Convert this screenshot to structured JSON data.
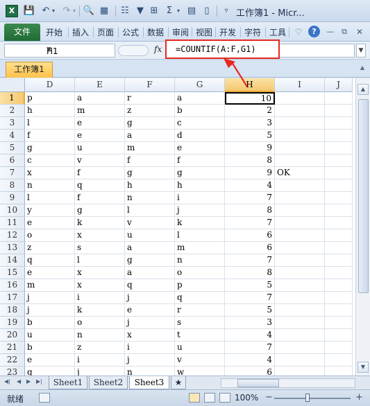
{
  "titlebar": {
    "app_icon": "X",
    "title": "工作簿1 - Micr...",
    "icons": [
      "excel-icon",
      "save-icon",
      "undo-icon",
      "redo-icon",
      "print-preview-icon",
      "format-icon",
      "filter-icon",
      "borders-icon",
      "sum-icon",
      "align-icon",
      "customize-icon"
    ]
  },
  "ribbon": {
    "file_tab": "文件",
    "tabs": [
      "开始",
      "插入",
      "页面",
      "公式",
      "数据",
      "审阅",
      "视图",
      "开发",
      "字符",
      "工具"
    ]
  },
  "formula_bar": {
    "name_box": "H1",
    "fx_label": "fx",
    "formula": "=COUNTIF(A:F,G1)"
  },
  "workbook_tab": "工作簿1",
  "grid": {
    "columns": [
      "D",
      "E",
      "F",
      "G",
      "H",
      "I",
      "J"
    ],
    "selected_column": "H",
    "selected_row": 1,
    "rows": [
      {
        "n": "1",
        "D": "p",
        "E": "a",
        "F": "r",
        "G": "a",
        "H": "10",
        "I": ""
      },
      {
        "n": "2",
        "D": "h",
        "E": "m",
        "F": "z",
        "G": "b",
        "H": "2",
        "I": ""
      },
      {
        "n": "3",
        "D": "l",
        "E": "e",
        "F": "g",
        "G": "c",
        "H": "3",
        "I": ""
      },
      {
        "n": "4",
        "D": "f",
        "E": "e",
        "F": "a",
        "G": "d",
        "H": "5",
        "I": ""
      },
      {
        "n": "5",
        "D": "g",
        "E": "u",
        "F": "m",
        "G": "e",
        "H": "9",
        "I": ""
      },
      {
        "n": "6",
        "D": "c",
        "E": "v",
        "F": "f",
        "G": "f",
        "H": "8",
        "I": ""
      },
      {
        "n": "7",
        "D": "x",
        "E": "f",
        "F": "g",
        "G": "g",
        "H": "9",
        "I": "OK"
      },
      {
        "n": "8",
        "D": "n",
        "E": "q",
        "F": "h",
        "G": "h",
        "H": "4",
        "I": ""
      },
      {
        "n": "9",
        "D": "l",
        "E": "f",
        "F": "n",
        "G": "i",
        "H": "7",
        "I": ""
      },
      {
        "n": "10",
        "D": "y",
        "E": "g",
        "F": "l",
        "G": "j",
        "H": "8",
        "I": ""
      },
      {
        "n": "11",
        "D": "e",
        "E": "k",
        "F": "v",
        "G": "k",
        "H": "7",
        "I": ""
      },
      {
        "n": "12",
        "D": "o",
        "E": "x",
        "F": "u",
        "G": "l",
        "H": "6",
        "I": ""
      },
      {
        "n": "13",
        "D": "z",
        "E": "s",
        "F": "a",
        "G": "m",
        "H": "6",
        "I": ""
      },
      {
        "n": "14",
        "D": "q",
        "E": "l",
        "F": "g",
        "G": "n",
        "H": "7",
        "I": ""
      },
      {
        "n": "15",
        "D": "e",
        "E": "x",
        "F": "a",
        "G": "o",
        "H": "8",
        "I": ""
      },
      {
        "n": "16",
        "D": "m",
        "E": "x",
        "F": "q",
        "G": "p",
        "H": "5",
        "I": ""
      },
      {
        "n": "17",
        "D": "j",
        "E": "i",
        "F": "j",
        "G": "q",
        "H": "7",
        "I": ""
      },
      {
        "n": "18",
        "D": "j",
        "E": "k",
        "F": "e",
        "G": "r",
        "H": "5",
        "I": ""
      },
      {
        "n": "19",
        "D": "b",
        "E": "o",
        "F": "j",
        "G": "s",
        "H": "3",
        "I": ""
      },
      {
        "n": "20",
        "D": "u",
        "E": "n",
        "F": "x",
        "G": "t",
        "H": "4",
        "I": ""
      },
      {
        "n": "21",
        "D": "b",
        "E": "z",
        "F": "i",
        "G": "u",
        "H": "7",
        "I": ""
      },
      {
        "n": "22",
        "D": "e",
        "E": "i",
        "F": "j",
        "G": "v",
        "H": "4",
        "I": ""
      },
      {
        "n": "23",
        "D": "q",
        "E": "j",
        "F": "n",
        "G": "w",
        "H": "6",
        "I": ""
      }
    ]
  },
  "sheets": [
    "Sheet1",
    "Sheet2",
    "Sheet3"
  ],
  "active_sheet": "Sheet3",
  "status": {
    "ready": "就绪",
    "zoom": "100%"
  },
  "colors": {
    "highlight_border": "#e8281e",
    "selected_header": "#f5c770",
    "file_tab": "#1f6b35"
  }
}
